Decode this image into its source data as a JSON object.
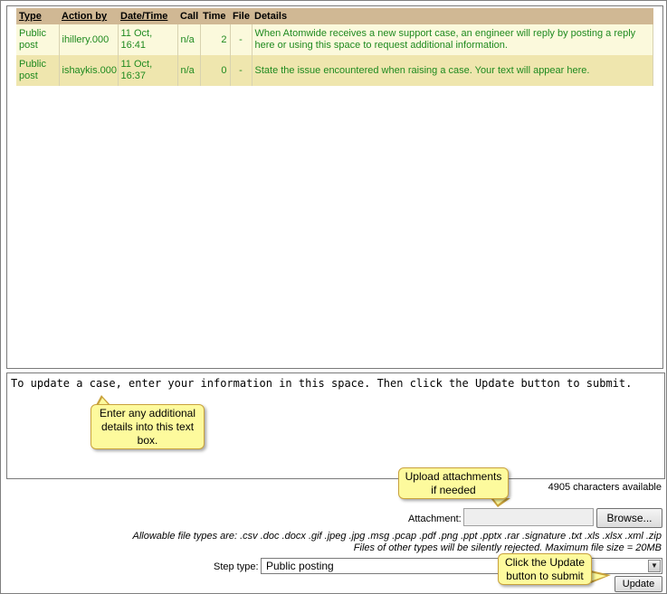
{
  "history": {
    "columns": [
      "Type",
      "Action by",
      "Date/Time",
      "Call",
      "Time",
      "File",
      "Details"
    ],
    "rows": [
      {
        "type": "Public post",
        "action_by": "ihillery.000",
        "datetime": "11 Oct, 16:41",
        "call": "n/a",
        "time": "2",
        "file": "-",
        "details": "When Atomwide receives a new support case, an engineer will reply by posting a reply here or using this space to request additional information."
      },
      {
        "type": "Public post",
        "action_by": "ishaykis.000",
        "datetime": "11 Oct, 16:37",
        "call": "n/a",
        "time": "0",
        "file": "-",
        "details": "State the issue encountered when raising a case. Your text will appear here."
      }
    ]
  },
  "editor": {
    "text": "To update a case, enter your information in this space. Then click the Update button to submit.",
    "chars_available": "4905 characters available"
  },
  "attachment": {
    "label": "Attachment:",
    "browse_label": "Browse...",
    "types_note": "Allowable file types are: .csv .doc .docx .gif .jpeg .jpg .msg .pcap .pdf .png .ppt .pptx .rar .signature .txt .xls .xlsx .xml .zip",
    "reject_note": "Files of other types will be silently rejected. Maximum file size = 20MB"
  },
  "step": {
    "label": "Step type:",
    "selected": "Public posting"
  },
  "update_label": "Update",
  "callouts": {
    "details": "Enter any additional details into this text box.",
    "upload": "Upload attachments if needed",
    "update": "Click the Update button to submit"
  },
  "colors": {
    "header_bg": "#d0b894",
    "row1_bg": "#fbf9dc",
    "row2_bg": "#efe6ae",
    "row_text": "#1f8a1f",
    "callout_bg": "#fdfa9d"
  }
}
